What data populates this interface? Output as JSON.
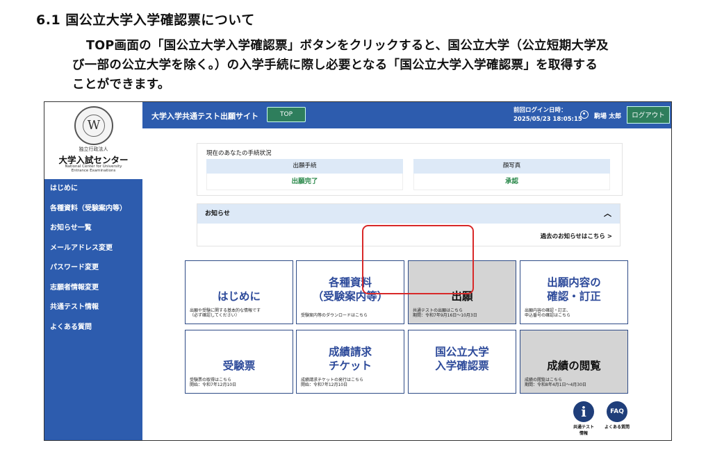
{
  "doc": {
    "heading": "6.1 国公立大学入学確認票について",
    "paragraph_lines": [
      "TOP画面の「国公立大学入学確認票」ボタンをクリックすると、国公立大学（公立短期大学及",
      "び一部の公立大学を除く。）の入学手続に際し必要となる「国公立大学入学確認票」を取得する",
      "ことができます。"
    ]
  },
  "logo": {
    "seal_letter": "W",
    "org_type": "独立行政法人",
    "org_name": "大学入試センター",
    "org_en_1": "National Center for University",
    "org_en_2": "Entrance Examinations"
  },
  "sidebar": {
    "items": [
      {
        "label": "はじめに"
      },
      {
        "label": "各種資料（受験案内等）"
      },
      {
        "label": "お知らせ一覧"
      },
      {
        "label": "メールアドレス変更"
      },
      {
        "label": "パスワード変更"
      },
      {
        "label": "志願者情報変更"
      },
      {
        "label": "共通テスト情報"
      },
      {
        "label": "よくある質問"
      }
    ]
  },
  "header": {
    "site_title": "大学入学共通テスト出願サイト",
    "top_button": "TOP",
    "last_login_label": "前回ログイン日時：",
    "last_login_value": "2025/05/23 18:05:15",
    "user_name": "駒場 太郎",
    "logout_button": "ログアウト"
  },
  "status": {
    "caption": "現在のあなたの手続状況",
    "col1_head": "出願手続",
    "col1_value": "出願完了",
    "col2_head": "顔写真",
    "col2_value": "承認"
  },
  "notice": {
    "title": "お知らせ",
    "chevron": "︿",
    "past_link": "過去のお知らせはこちら >"
  },
  "tiles": [
    {
      "title_1": "",
      "title_2": "はじめに",
      "desc_1": "出願や受験に関する基本的な情報です",
      "desc_2": "（必ず確認してください）"
    },
    {
      "title_1": "各種資料",
      "title_2": "（受験案内等）",
      "desc_1": "受験案内等のダウンロードはこちら",
      "desc_2": ""
    },
    {
      "title_1": "",
      "title_2": "出願",
      "desc_1": "共通テストの出願はこちら",
      "desc_2": "期間：令和7年9月16日～10月3日"
    },
    {
      "title_1": "出願内容の",
      "title_2": "確認・訂正",
      "desc_1": "出願内容の確認・訂正、",
      "desc_2": "申込番号の確認はこちら"
    },
    {
      "title_1": "",
      "title_2": "受験票",
      "desc_1": "受験票の取得はこちら",
      "desc_2": "開始：令和7年12月10日"
    },
    {
      "title_1": "成績請求",
      "title_2": "チケット",
      "desc_1": "成績請求チケットの発行はこちら",
      "desc_2": "開始：令和7年12月10日"
    },
    {
      "title_1": "国公立大学",
      "title_2": "入学確認票",
      "desc_1": "",
      "desc_2": ""
    },
    {
      "title_1": "",
      "title_2": "成績の閲覧",
      "desc_1": "成績の閲覧はこちら",
      "desc_2": "期間：令和8年4月1日～4月30日"
    }
  ],
  "quick_links": {
    "info_icon_glyph": "i",
    "info_label_1": "共通テスト",
    "info_label_2": "情報",
    "faq_icon_glyph": "FAQ",
    "faq_label": "よくある質問"
  },
  "colors": {
    "nav_blue": "#2d5cae",
    "button_green": "#2e7e5c",
    "highlight_red": "#d82828",
    "tile_border": "#2d4a86"
  }
}
